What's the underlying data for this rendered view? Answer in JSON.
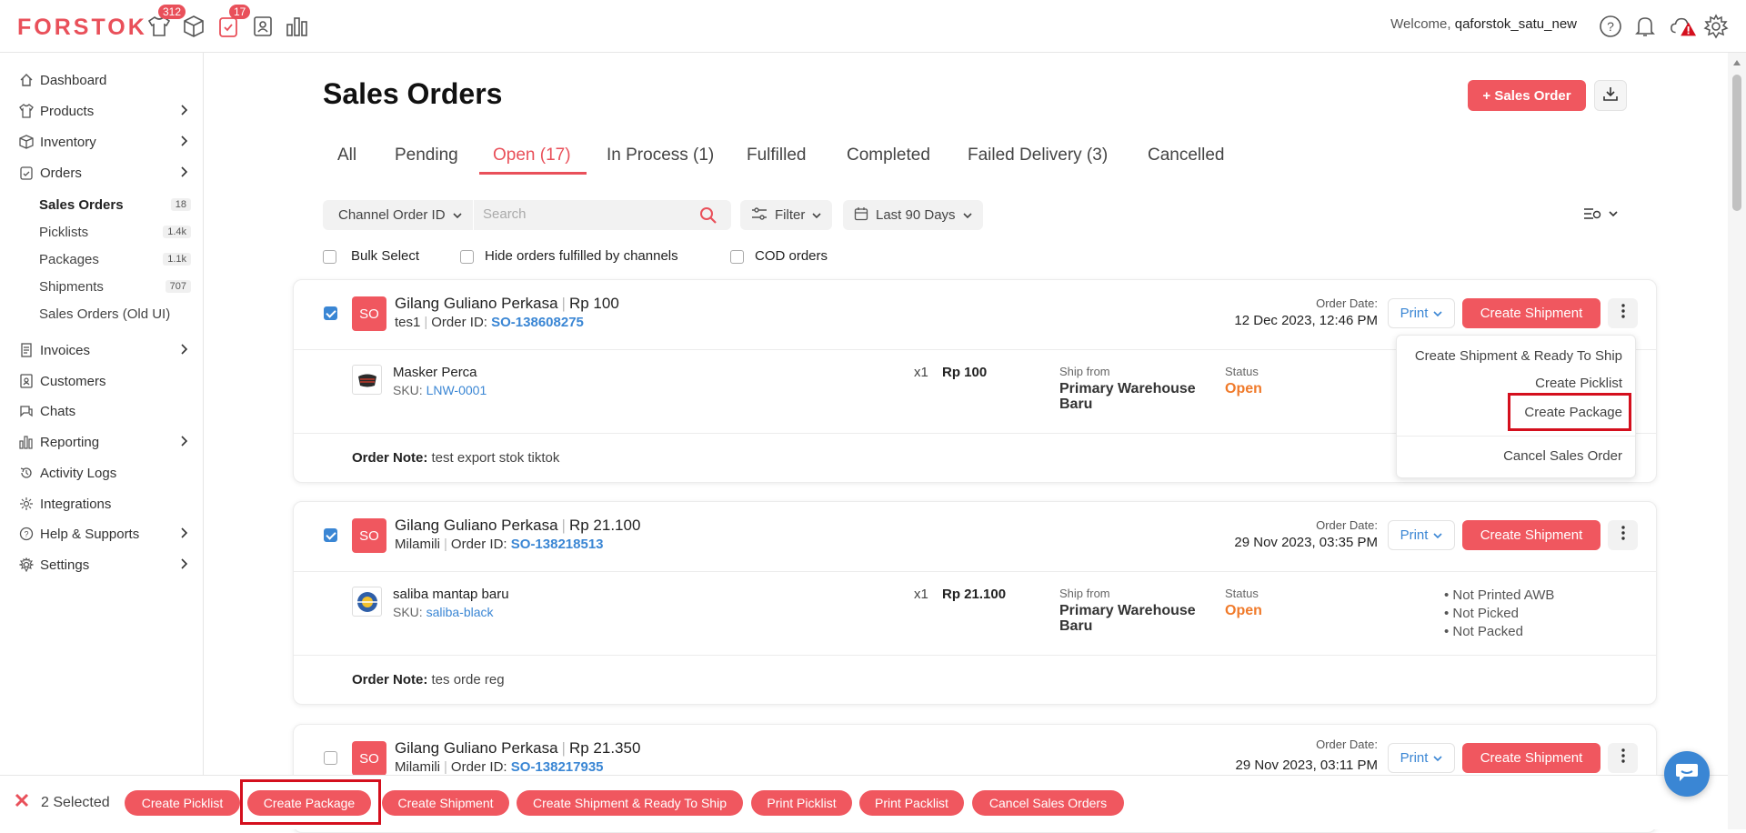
{
  "app": {
    "logo": "FORSTOK",
    "badges": {
      "products": "312",
      "orders": "17"
    },
    "welcome_prefix": "Welcome, ",
    "username": "qaforstok_satu_new"
  },
  "sidebar": {
    "dashboard": "Dashboard",
    "products": "Products",
    "inventory": "Inventory",
    "orders": "Orders",
    "sub": [
      {
        "label": "Sales Orders",
        "count": "18"
      },
      {
        "label": "Picklists",
        "count": "1.4k"
      },
      {
        "label": "Packages",
        "count": "1.1k"
      },
      {
        "label": "Shipments",
        "count": "707"
      },
      {
        "label": "Sales Orders (Old UI)",
        "count": ""
      }
    ],
    "invoices": "Invoices",
    "customers": "Customers",
    "chats": "Chats",
    "reporting": "Reporting",
    "activity_logs": "Activity Logs",
    "integrations": "Integrations",
    "help": "Help & Supports",
    "settings": "Settings"
  },
  "page": {
    "title": "Sales Orders",
    "new_order": "+ Sales Order"
  },
  "tabs": [
    "All",
    "Pending",
    "Open (17)",
    "In Process (1)",
    "Fulfilled",
    "Completed",
    "Failed Delivery (3)",
    "Cancelled"
  ],
  "toolbar": {
    "field_select": "Channel Order ID",
    "search_placeholder": "Search",
    "filter": "Filter",
    "date_range": "Last 90 Days"
  },
  "checkboxes": {
    "bulk_select": "Bulk Select",
    "hide_fulfilled": "Hide orders fulfilled by channels",
    "cod": "COD orders"
  },
  "labels": {
    "order_date": "Order Date:",
    "print": "Print",
    "create_shipment": "Create Shipment",
    "ship_from": "Ship from",
    "status": "Status",
    "order_note": "Order Note:",
    "order_id_prefix": "Order ID: ",
    "sku_prefix": "SKU: "
  },
  "orders": [
    {
      "checked": true,
      "badge": "SO",
      "customer": "Gilang Guliano Perkasa",
      "total": "Rp 100",
      "store": "tes1",
      "order_id": "SO-138608275",
      "date": "12 Dec 2023, 12:46 PM",
      "product": "Masker Perca",
      "sku": "LNW-0001",
      "qty": "x1",
      "price": "Rp 100",
      "warehouse": "Primary Warehouse Baru",
      "status": "Open",
      "note": "test export stok tiktok"
    },
    {
      "checked": true,
      "badge": "SO",
      "customer": "Gilang Guliano Perkasa",
      "total": "Rp 21.100",
      "store": "Milamili",
      "order_id": "SO-138218513",
      "date": "29 Nov 2023, 03:35 PM",
      "product": "saliba mantap baru",
      "sku": "saliba-black",
      "qty": "x1",
      "price": "Rp 21.100",
      "warehouse": "Primary Warehouse Baru",
      "status": "Open",
      "flags": [
        "• Not Printed AWB",
        "• Not Picked",
        "• Not Packed"
      ],
      "note": "tes orde reg"
    },
    {
      "checked": false,
      "badge": "SO",
      "customer": "Gilang Guliano Perkasa",
      "total": "Rp 21.350",
      "store": "Milamili",
      "order_id": "SO-138217935",
      "date": "29 Nov 2023, 03:11 PM"
    }
  ],
  "dropdown": [
    "Create Shipment & Ready To Ship",
    "Create Picklist",
    "Create Package",
    "Cancel Sales Order"
  ],
  "bulk": {
    "selected": "2 Selected",
    "actions": [
      "Create Picklist",
      "Create Package",
      "Create Shipment",
      "Create Shipment & Ready To Ship",
      "Print Picklist",
      "Print Packlist",
      "Cancel Sales Orders"
    ]
  },
  "colors": {
    "brand": "#f0575f",
    "link": "#3a86d4",
    "status_open": "#f07a2a",
    "highlight": "#d40f1d"
  }
}
